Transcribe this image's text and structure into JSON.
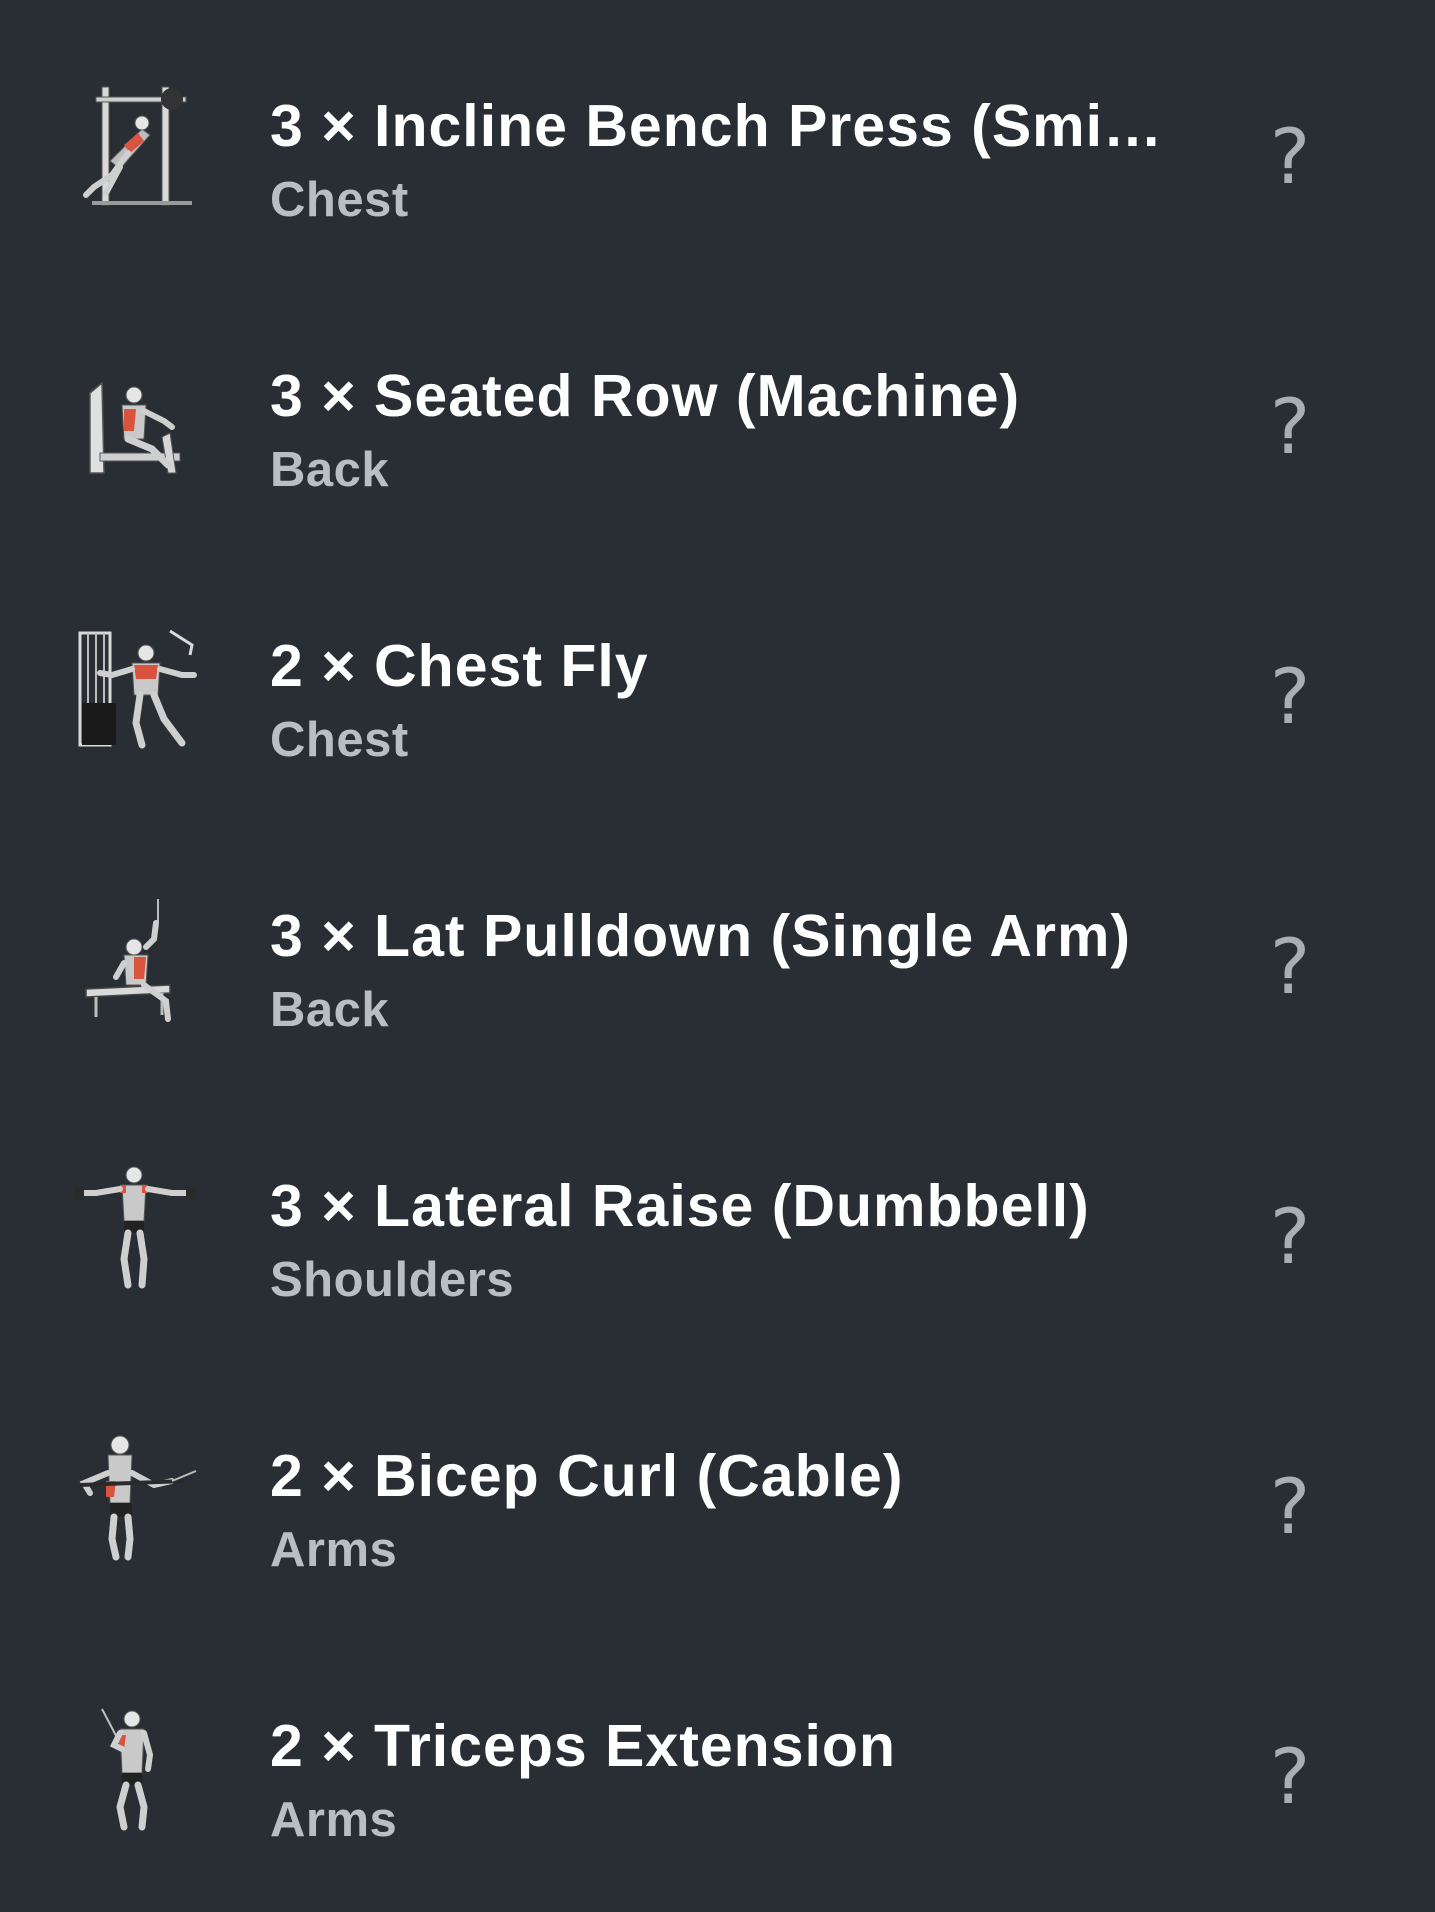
{
  "exercises": [
    {
      "title": "3 × Incline Bench Press (Smit…",
      "muscle": "Chest",
      "icon": "incline-bench-press-smith-icon",
      "help": "?"
    },
    {
      "title": "3 × Seated Row (Machine)",
      "muscle": "Back",
      "icon": "seated-row-machine-icon",
      "help": "?"
    },
    {
      "title": "2 × Chest Fly",
      "muscle": "Chest",
      "icon": "chest-fly-machine-icon",
      "help": "?"
    },
    {
      "title": "3 × Lat Pulldown (Single Arm)",
      "muscle": "Back",
      "icon": "single-arm-lat-pulldown-icon",
      "help": "?"
    },
    {
      "title": "3 × Lateral Raise (Dumbbell)",
      "muscle": "Shoulders",
      "icon": "dumbbell-lateral-raise-icon",
      "help": "?"
    },
    {
      "title": "2 × Bicep Curl (Cable)",
      "muscle": "Arms",
      "icon": "cable-bicep-curl-icon",
      "help": "?"
    },
    {
      "title": "2 × Triceps Extension",
      "muscle": "Arms",
      "icon": "triceps-extension-icon",
      "help": "?"
    }
  ],
  "colors": {
    "background": "#292e34",
    "title": "#ffffff",
    "subtitle": "#b9bec4",
    "help_icon": "#a9aeb4",
    "muscle_highlight": "#d9533f"
  }
}
